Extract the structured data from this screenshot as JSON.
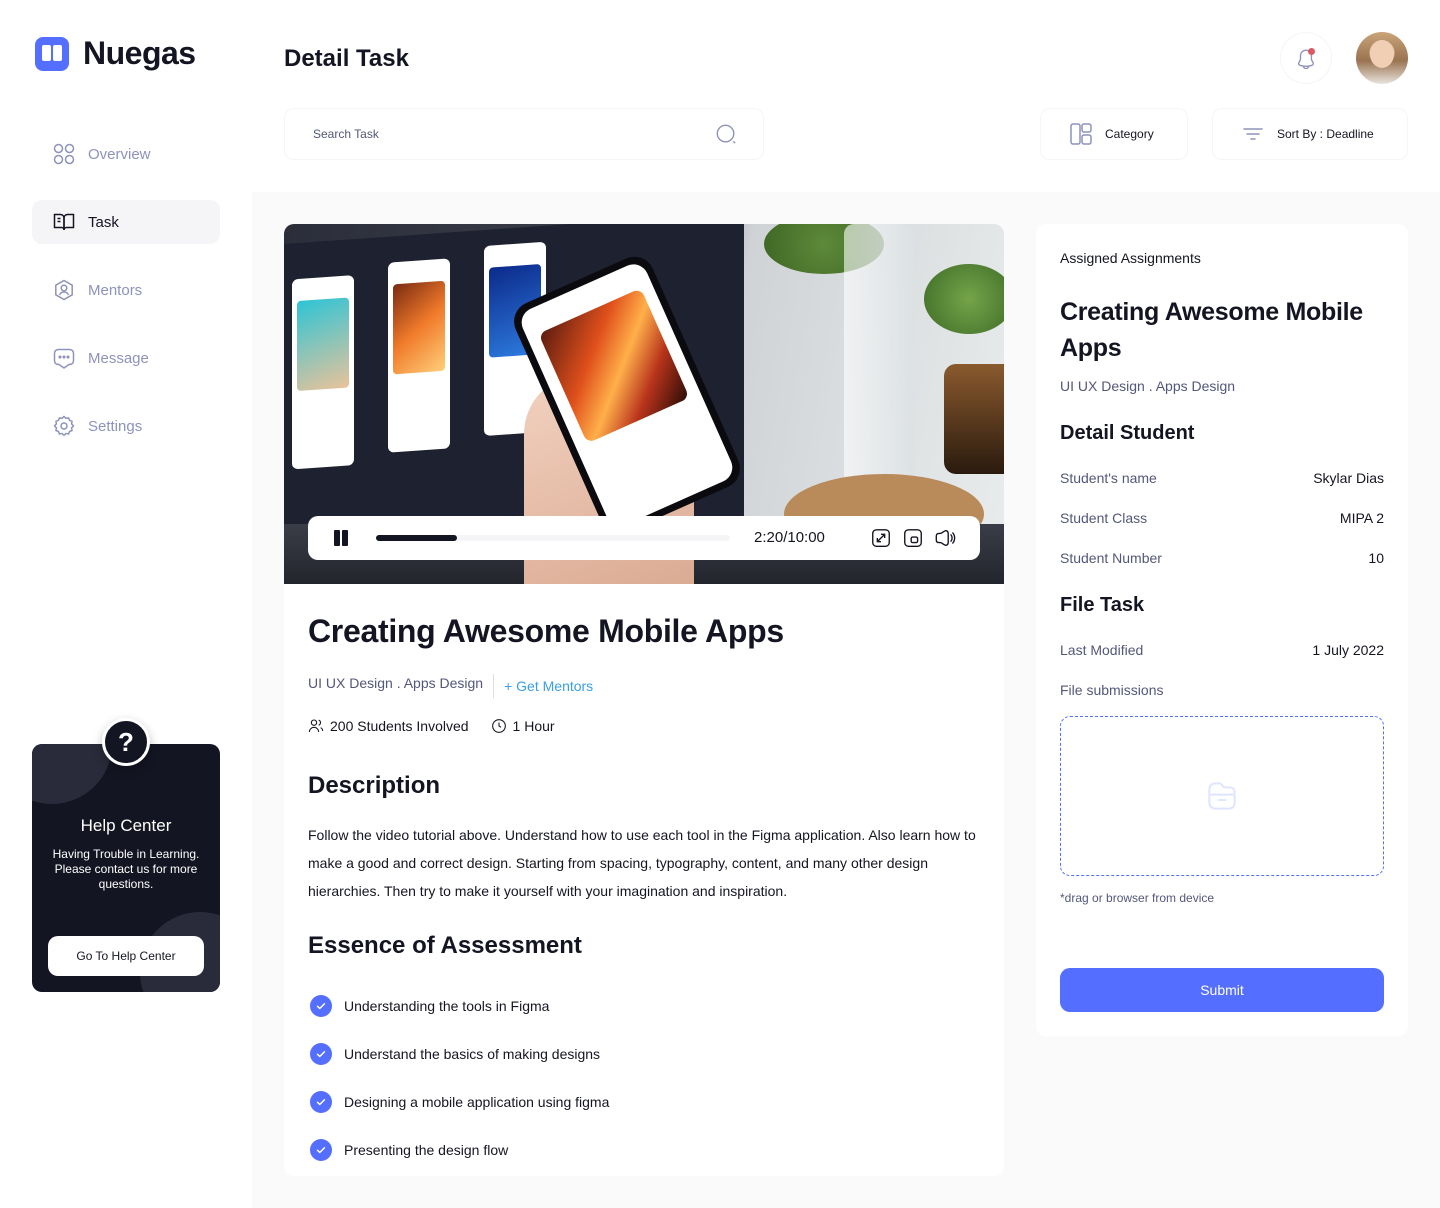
{
  "app": {
    "name": "Nuegas"
  },
  "sidebar": {
    "items": [
      {
        "label": "Overview",
        "icon": "grid-icon",
        "active": false
      },
      {
        "label": "Task",
        "icon": "book-icon",
        "active": true
      },
      {
        "label": "Mentors",
        "icon": "user-icon",
        "active": false
      },
      {
        "label": "Message",
        "icon": "chat-icon",
        "active": false
      },
      {
        "label": "Settings",
        "icon": "gear-icon",
        "active": false
      }
    ],
    "help": {
      "icon_glyph": "?",
      "title": "Help Center",
      "text": "Having Trouble in Learning. Please contact us for more questions.",
      "button": "Go To Help Center"
    }
  },
  "header": {
    "title": "Detail Task",
    "search_placeholder": "Search Task",
    "category_label": "Category",
    "sort_label": "Sort By : Deadline"
  },
  "video": {
    "time": "2:20/10:00",
    "progress": 0.23
  },
  "course": {
    "title": "Creating Awesome Mobile Apps",
    "category": "UI UX Design . Apps Design",
    "mentor_link": "+ Get Mentors",
    "students": "200 Students Involved",
    "duration": "1 Hour",
    "description_title": "Description",
    "description": "Follow the video tutorial above. Understand how to use each tool in the Figma application. Also learn how to make a good and correct design. Starting from spacing, typography, content, and many other design hierarchies. Then try to make it yourself with your imagination and inspiration.",
    "essence_title": "Essence of Assessment",
    "essence": [
      "Understanding the tools in Figma",
      "Understand the basics of making designs",
      "Designing a mobile application using figma",
      "Presenting the design flow"
    ]
  },
  "assignment": {
    "label": "Assigned Assignments",
    "title": "Creating Awesome Mobile Apps",
    "category": "UI UX Design . Apps Design",
    "student_heading": "Detail Student",
    "student": [
      {
        "key": "Student's name",
        "value": "Skylar Dias"
      },
      {
        "key": "Student Class",
        "value": "MIPA 2"
      },
      {
        "key": "Student Number",
        "value": "10"
      }
    ],
    "file_heading": "File Task",
    "last_modified_key": "Last Modified",
    "last_modified_value": "1 July 2022",
    "submissions_label": "File submissions",
    "drop_note": "*drag or browser from device",
    "submit": "Submit"
  },
  "colors": {
    "accent": "#546FFF",
    "dark": "#141522",
    "muted": "#54577A",
    "link": "#3AA0E4"
  }
}
